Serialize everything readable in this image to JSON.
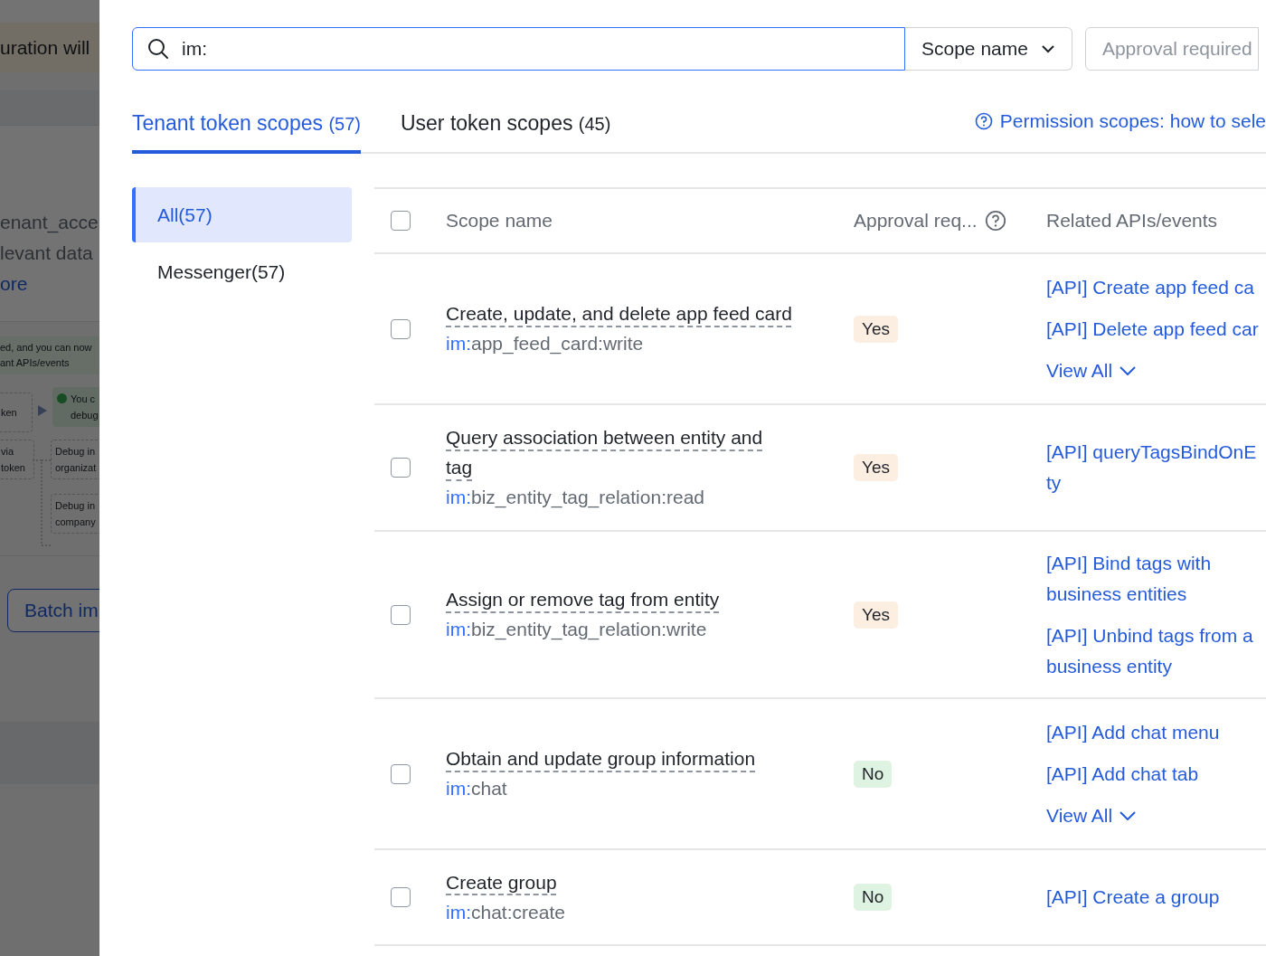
{
  "background_page": {
    "banner": "uration will",
    "description_lines": [
      "enant_acce",
      "levant data"
    ],
    "more_link": "ore",
    "notice_lines": [
      "ed, and you can now",
      "ant APIs/events"
    ],
    "flow_nodes": [
      {
        "kind": "plain",
        "lines": [
          "ken"
        ]
      },
      {
        "kind": "success",
        "lines": [
          "You c",
          "debug"
        ]
      },
      {
        "kind": "plain",
        "lines": [
          "via",
          "token"
        ]
      },
      {
        "kind": "plain",
        "lines": [
          "Debug in",
          "organizat"
        ]
      },
      {
        "kind": "plain",
        "lines": [
          "Debug in",
          "company"
        ]
      }
    ],
    "batch_button": "Batch im"
  },
  "search": {
    "value": "im:"
  },
  "filters": [
    {
      "kind": "select",
      "label": "Scope name"
    },
    {
      "kind": "placeholder",
      "label": "Approval required"
    }
  ],
  "tabs": [
    {
      "label": "Tenant token scopes",
      "count": "(57)",
      "selected": true
    },
    {
      "label": "User token scopes",
      "count": "(45)",
      "selected": false
    }
  ],
  "help_link": "Permission scopes: how to sele",
  "categories": [
    {
      "label": "All(57)",
      "selected": true
    },
    {
      "label": "Messenger(57)",
      "selected": false
    }
  ],
  "table": {
    "columns": [
      "Scope name",
      "Approval req...",
      "Related APIs/events"
    ],
    "header_checked": false,
    "rows": [
      {
        "checked": false,
        "name_lines": [
          "Create, update, and delete app feed card"
        ],
        "scope_prefix": "im:",
        "scope_rest": "app_feed_card:write",
        "approval": {
          "kind": "yes",
          "text": "Yes"
        },
        "apis": [
          {
            "kind": "link",
            "lines": [
              "[API] Create app feed ca"
            ]
          },
          {
            "kind": "link",
            "lines": [
              "[API] Delete app feed car"
            ]
          },
          {
            "kind": "view_all",
            "lines": [
              "View All"
            ]
          }
        ]
      },
      {
        "checked": false,
        "name_lines": [
          "Query association between entity and",
          "tag"
        ],
        "scope_prefix": "im:",
        "scope_rest": "biz_entity_tag_relation:read",
        "approval": {
          "kind": "yes",
          "text": "Yes"
        },
        "apis": [
          {
            "kind": "link",
            "lines": [
              "[API] queryTagsBindOnE",
              "ty"
            ]
          }
        ]
      },
      {
        "checked": false,
        "name_lines": [
          "Assign or remove tag from entity"
        ],
        "scope_prefix": "im:",
        "scope_rest": "biz_entity_tag_relation:write",
        "approval": {
          "kind": "yes",
          "text": "Yes"
        },
        "apis": [
          {
            "kind": "link",
            "lines": [
              "[API] Bind tags with",
              "business entities"
            ]
          },
          {
            "kind": "link",
            "lines": [
              "[API] Unbind tags from a",
              "business entity"
            ]
          }
        ]
      },
      {
        "checked": false,
        "name_lines": [
          "Obtain and update group information"
        ],
        "scope_prefix": "im:",
        "scope_rest": "chat",
        "approval": {
          "kind": "no",
          "text": "No"
        },
        "apis": [
          {
            "kind": "link",
            "lines": [
              "[API] Add chat menu"
            ]
          },
          {
            "kind": "link",
            "lines": [
              "[API] Add chat tab"
            ]
          },
          {
            "kind": "view_all",
            "lines": [
              "View All"
            ]
          }
        ]
      },
      {
        "checked": false,
        "name_lines": [
          "Create group"
        ],
        "scope_prefix": "im:",
        "scope_rest": "chat:create",
        "approval": {
          "kind": "no",
          "text": "No"
        },
        "apis": [
          {
            "kind": "link",
            "lines": [
              "[API] Create a group"
            ]
          }
        ]
      }
    ]
  }
}
